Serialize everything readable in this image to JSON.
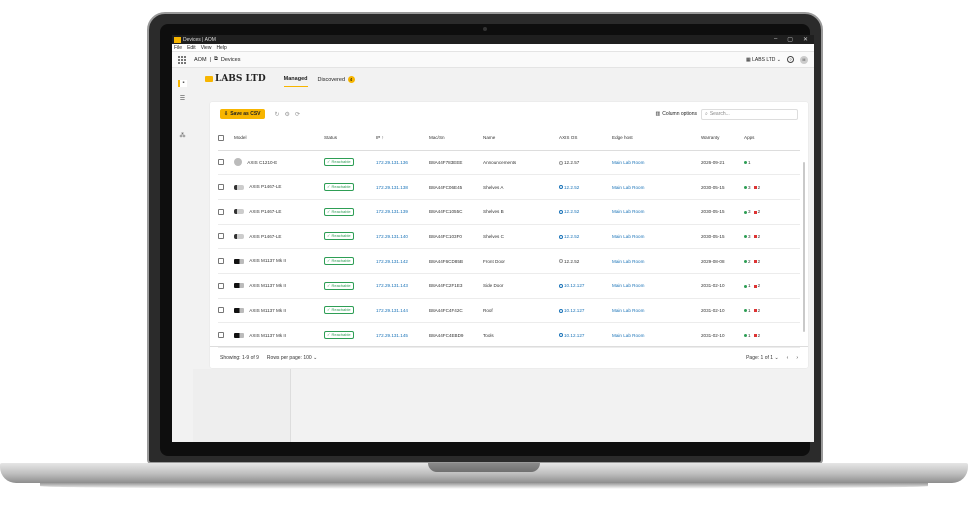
{
  "window": {
    "title": "Devices | AOM",
    "controls": [
      "–",
      "▢",
      "✕"
    ]
  },
  "menu": [
    "File",
    "Edit",
    "View",
    "Help"
  ],
  "topbar": {
    "app": "AOM",
    "section": "Devices",
    "org_selector": "LABS LTD",
    "avatar": "M"
  },
  "header": {
    "org_name": "LABS LTD",
    "tabs": [
      {
        "label": "Managed"
      },
      {
        "label": "Discovered",
        "badge": "4"
      }
    ]
  },
  "toolbar": {
    "save_label": "Save as CSV",
    "column_options": "Column options",
    "search_placeholder": "Search..."
  },
  "table": {
    "columns": [
      "Model",
      "Status",
      "IP",
      "Mac/Sn",
      "Name",
      "AXIS OS",
      "Edge host",
      "Warranty",
      "Apps"
    ],
    "rows": [
      {
        "model": "AXIS C1210-E",
        "icon": "dome",
        "status": "Reachable",
        "ip": "172.29.131.136",
        "mac": "B8A44F783EEE",
        "name": "Announcements",
        "os": "12.2.57",
        "os_link": false,
        "edge": "Main Lab Room",
        "warranty": "2026-09-21",
        "apps_green": "1",
        "apps_red": ""
      },
      {
        "model": "AXIS P1467-LE",
        "icon": "bullet",
        "status": "Reachable",
        "ip": "172.29.131.138",
        "mac": "B8A44FC06E45",
        "name": "Shelves A",
        "os": "12.2.52",
        "os_link": true,
        "edge": "Main Lab Room",
        "warranty": "2030-05-15",
        "apps_green": "3",
        "apps_red": "2"
      },
      {
        "model": "AXIS P1467-LE",
        "icon": "bullet",
        "status": "Reachable",
        "ip": "172.29.131.139",
        "mac": "B8A44FC1055C",
        "name": "Shelves B",
        "os": "12.2.52",
        "os_link": true,
        "edge": "Main Lab Room",
        "warranty": "2030-05-15",
        "apps_green": "3",
        "apps_red": "2"
      },
      {
        "model": "AXIS P1467-LE",
        "icon": "bullet",
        "status": "Reachable",
        "ip": "172.29.131.140",
        "mac": "B8A44FC103F0",
        "name": "Shelves C",
        "os": "12.2.52",
        "os_link": true,
        "edge": "Main Lab Room",
        "warranty": "2030-05-15",
        "apps_green": "3",
        "apps_red": "2"
      },
      {
        "model": "AXIS M1137 Mk II",
        "icon": "box",
        "status": "Reachable",
        "ip": "172.29.131.142",
        "mac": "B8A44F6CD85B",
        "name": "Front Door",
        "os": "12.2.52",
        "os_link": false,
        "edge": "Main Lab Room",
        "warranty": "2029-08-08",
        "apps_green": "2",
        "apps_red": "2"
      },
      {
        "model": "AXIS M1137 Mk II",
        "icon": "box",
        "status": "Reachable",
        "ip": "172.29.131.143",
        "mac": "B8A44FC2F1E3",
        "name": "Side Door",
        "os": "10.12.127",
        "os_link": true,
        "edge": "Main Lab Room",
        "warranty": "2031-02-10",
        "apps_green": "1",
        "apps_red": "2"
      },
      {
        "model": "AXIS M1137 Mk II",
        "icon": "box",
        "status": "Reachable",
        "ip": "172.29.131.144",
        "mac": "B8A44FC4F42C",
        "name": "Roof",
        "os": "10.12.127",
        "os_link": true,
        "edge": "Main Lab Room",
        "warranty": "2031-02-10",
        "apps_green": "1",
        "apps_red": "2"
      },
      {
        "model": "AXIS M1137 Mk II",
        "icon": "box",
        "status": "Reachable",
        "ip": "172.29.131.145",
        "mac": "B8A44FC4EBD9",
        "name": "Tools",
        "os": "10.12.127",
        "os_link": true,
        "edge": "Main Lab Room",
        "warranty": "2031-02-10",
        "apps_green": "1",
        "apps_red": "2"
      }
    ]
  },
  "footer": {
    "showing": "Showing: 1-9 of 9",
    "rows_per_page": "Rows per page: 100",
    "page": "Page: 1 of 1"
  },
  "colors": {
    "accent": "#f7b500",
    "link": "#1a73b8",
    "ok": "#2e9e55",
    "error": "#dd3333"
  }
}
